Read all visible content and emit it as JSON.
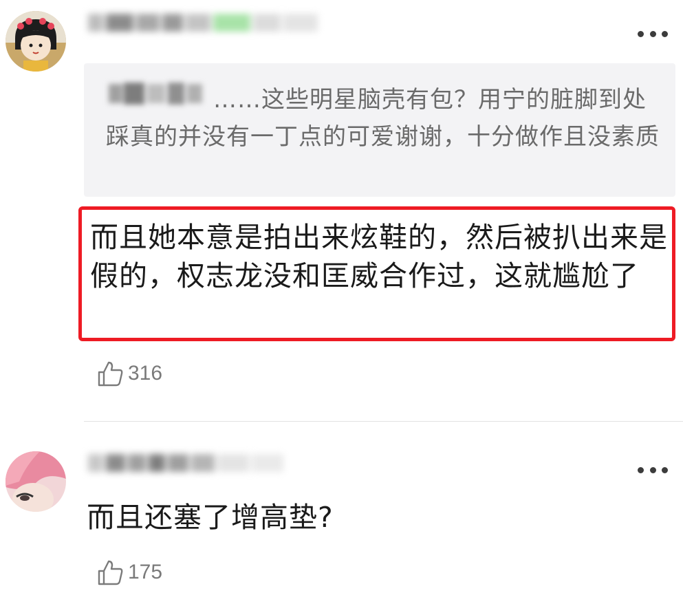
{
  "comments": [
    {
      "avatar": "cartoon-girl-avatar",
      "quote": {
        "text": "……这些明星脑壳有包？用宁的脏脚到处踩真的并没有一丁点的可爱谢谢，十分做作且没素质"
      },
      "text": "而且她本意是拍出来炫鞋的，然后被扒出来是假的，权志龙没和匡威合作过，这就尴尬了",
      "likes": "316",
      "highlight_color": "#ee1b24"
    },
    {
      "avatar": "pink-hair-avatar",
      "text": "而且还塞了增高垫?",
      "likes": "175"
    }
  ],
  "icons": {
    "more": "more-dots-icon",
    "like": "thumbs-up-icon"
  }
}
